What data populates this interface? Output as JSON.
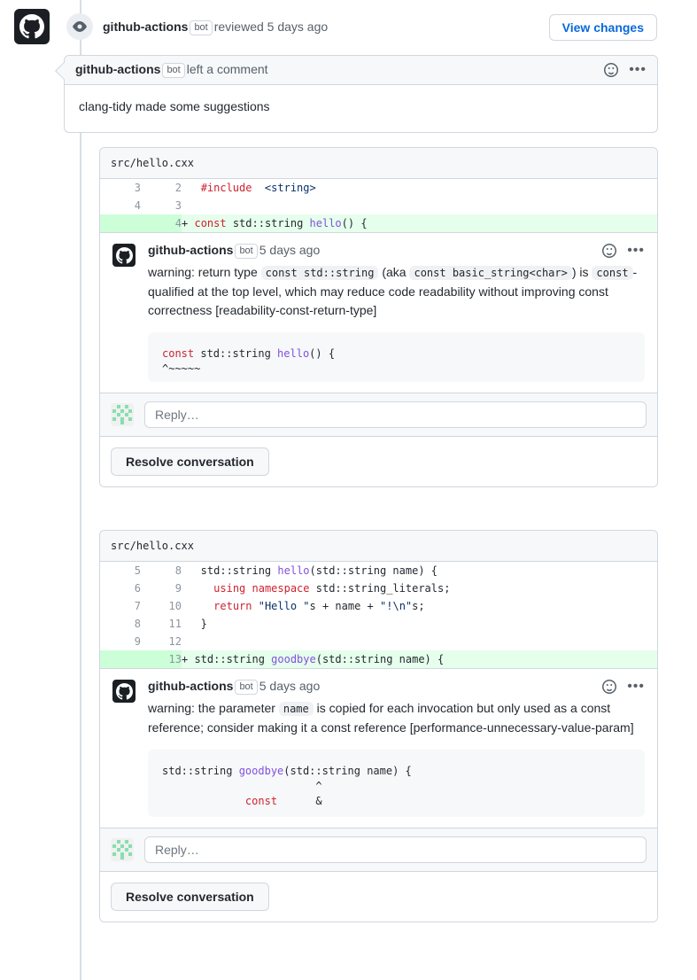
{
  "review": {
    "org_avatar_icon": "github-mark-icon",
    "state_icon": "eye-icon",
    "author": "github-actions",
    "bot_badge": "bot",
    "action_text": "reviewed 5 days ago",
    "view_changes_label": "View changes"
  },
  "summary_comment": {
    "author": "github-actions",
    "bot_badge": "bot",
    "action_text": "left a comment",
    "reaction_icon": "smiley-icon",
    "menu_icon": "kebab-menu-icon",
    "body": "clang-tidy made some suggestions"
  },
  "threads": [
    {
      "file": "src/hello.cxx",
      "diff": [
        {
          "old": "3",
          "new": "2",
          "marker": " ",
          "type": "context",
          "tokens": [
            {
              "t": "  ",
              "c": "plain"
            },
            {
              "t": "#include",
              "c": "k"
            },
            {
              "t": "  <string>",
              "c": "str"
            }
          ]
        },
        {
          "old": "4",
          "new": "3",
          "marker": " ",
          "type": "context",
          "tokens": [
            {
              "t": "",
              "c": "plain"
            }
          ]
        },
        {
          "old": "",
          "new": "4",
          "marker": "+",
          "type": "add",
          "tokens": [
            {
              "t": " ",
              "c": "plain"
            },
            {
              "t": "const",
              "c": "k"
            },
            {
              "t": " std::string ",
              "c": "plain"
            },
            {
              "t": "hello",
              "c": "fn"
            },
            {
              "t": "() {",
              "c": "plain"
            }
          ]
        }
      ],
      "comment": {
        "author": "github-actions",
        "bot_badge": "bot",
        "timestamp": "5 days ago",
        "reaction_icon": "smiley-icon",
        "menu_icon": "kebab-menu-icon",
        "text_parts": [
          {
            "type": "text",
            "v": "warning: return type "
          },
          {
            "type": "code",
            "v": "const std::string"
          },
          {
            "type": "text",
            "v": " (aka "
          },
          {
            "type": "code",
            "v": "const basic_string<char>"
          },
          {
            "type": "text",
            "v": ") is "
          },
          {
            "type": "code",
            "v": "const"
          },
          {
            "type": "text",
            "v": "-qualified at the top level, which may reduce code readability without improving const correctness [readability-const-return-type]"
          }
        ],
        "code_block_tokens": [
          {
            "t": "const",
            "c": "k"
          },
          {
            "t": " std::string ",
            "c": "plain"
          },
          {
            "t": "hello",
            "c": "fn"
          },
          {
            "t": "() {\n^~~~~~",
            "c": "plain"
          }
        ]
      },
      "reply": {
        "avatar_icon": "identicon-avatar",
        "placeholder": "Reply…"
      },
      "resolve_label": "Resolve conversation"
    },
    {
      "file": "src/hello.cxx",
      "diff": [
        {
          "old": "5",
          "new": "8",
          "marker": " ",
          "type": "context",
          "tokens": [
            {
              "t": "  std::string ",
              "c": "plain"
            },
            {
              "t": "hello",
              "c": "fn"
            },
            {
              "t": "(std::string name) {",
              "c": "plain"
            }
          ]
        },
        {
          "old": "6",
          "new": "9",
          "marker": " ",
          "type": "context",
          "tokens": [
            {
              "t": "    ",
              "c": "plain"
            },
            {
              "t": "using namespace",
              "c": "k"
            },
            {
              "t": " std::string_literals;",
              "c": "plain"
            }
          ]
        },
        {
          "old": "7",
          "new": "10",
          "marker": " ",
          "type": "context",
          "tokens": [
            {
              "t": "    ",
              "c": "plain"
            },
            {
              "t": "return",
              "c": "k"
            },
            {
              "t": " ",
              "c": "plain"
            },
            {
              "t": "\"Hello \"",
              "c": "str"
            },
            {
              "t": "s + name + ",
              "c": "plain"
            },
            {
              "t": "\"!\\n\"",
              "c": "str"
            },
            {
              "t": "s;",
              "c": "plain"
            }
          ]
        },
        {
          "old": "8",
          "new": "11",
          "marker": " ",
          "type": "context",
          "tokens": [
            {
              "t": "  }",
              "c": "plain"
            }
          ]
        },
        {
          "old": "9",
          "new": "12",
          "marker": " ",
          "type": "context",
          "tokens": [
            {
              "t": "",
              "c": "plain"
            }
          ]
        },
        {
          "old": "",
          "new": "13",
          "marker": "+",
          "type": "add",
          "tokens": [
            {
              "t": " std::string ",
              "c": "plain"
            },
            {
              "t": "goodbye",
              "c": "fn"
            },
            {
              "t": "(std::string name) {",
              "c": "plain"
            }
          ]
        }
      ],
      "comment": {
        "author": "github-actions",
        "bot_badge": "bot",
        "timestamp": "5 days ago",
        "reaction_icon": "smiley-icon",
        "menu_icon": "kebab-menu-icon",
        "text_parts": [
          {
            "type": "text",
            "v": "warning: the parameter "
          },
          {
            "type": "code",
            "v": "name"
          },
          {
            "type": "text",
            "v": " is copied for each invocation but only used as a const reference; consider making it a const reference [performance-unnecessary-value-param]"
          }
        ],
        "code_block_tokens": [
          {
            "t": "std::string ",
            "c": "plain"
          },
          {
            "t": "goodbye",
            "c": "fn"
          },
          {
            "t": "(std::string name) {\n                        ^\n             ",
            "c": "plain"
          },
          {
            "t": "const",
            "c": "k"
          },
          {
            "t": "      &",
            "c": "plain"
          }
        ]
      },
      "reply": {
        "avatar_icon": "identicon-avatar",
        "placeholder": "Reply…"
      },
      "resolve_label": "Resolve conversation"
    }
  ],
  "colors": {
    "border": "#d0d7de",
    "surface": "#f6f8fa",
    "link": "#0969da",
    "diff_add_bg": "#e6ffec",
    "diff_add_gutter": "#ccffd8",
    "keyword": "#cf222e",
    "function": "#8250df",
    "string": "#0a3069",
    "muted": "#57606a"
  },
  "layout": {
    "thread_tops": [
      166,
      598
    ],
    "thread_heights": [
      418,
      456
    ]
  }
}
